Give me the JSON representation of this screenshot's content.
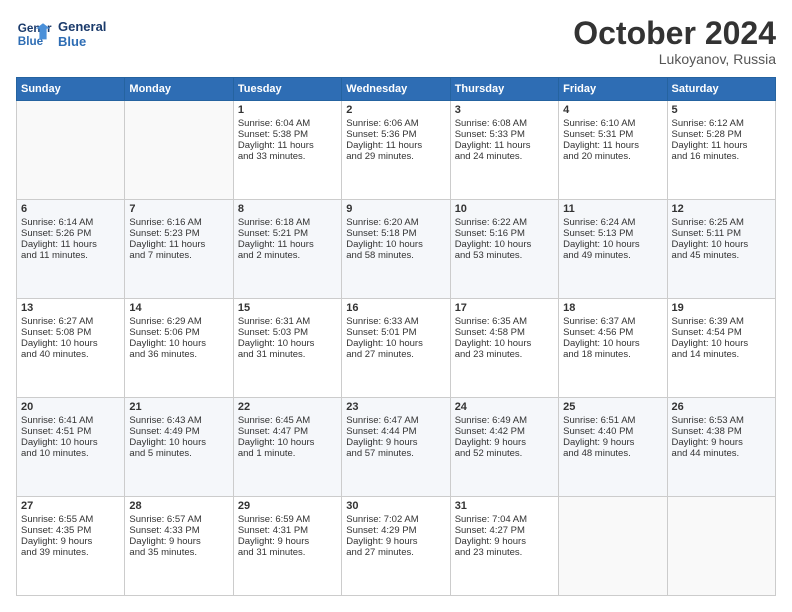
{
  "header": {
    "logo_line1": "General",
    "logo_line2": "Blue",
    "month": "October 2024",
    "location": "Lukoyanov, Russia"
  },
  "days_of_week": [
    "Sunday",
    "Monday",
    "Tuesday",
    "Wednesday",
    "Thursday",
    "Friday",
    "Saturday"
  ],
  "weeks": [
    [
      {
        "day": "",
        "content": ""
      },
      {
        "day": "",
        "content": ""
      },
      {
        "day": "1",
        "content": "Sunrise: 6:04 AM\nSunset: 5:38 PM\nDaylight: 11 hours\nand 33 minutes."
      },
      {
        "day": "2",
        "content": "Sunrise: 6:06 AM\nSunset: 5:36 PM\nDaylight: 11 hours\nand 29 minutes."
      },
      {
        "day": "3",
        "content": "Sunrise: 6:08 AM\nSunset: 5:33 PM\nDaylight: 11 hours\nand 24 minutes."
      },
      {
        "day": "4",
        "content": "Sunrise: 6:10 AM\nSunset: 5:31 PM\nDaylight: 11 hours\nand 20 minutes."
      },
      {
        "day": "5",
        "content": "Sunrise: 6:12 AM\nSunset: 5:28 PM\nDaylight: 11 hours\nand 16 minutes."
      }
    ],
    [
      {
        "day": "6",
        "content": "Sunrise: 6:14 AM\nSunset: 5:26 PM\nDaylight: 11 hours\nand 11 minutes."
      },
      {
        "day": "7",
        "content": "Sunrise: 6:16 AM\nSunset: 5:23 PM\nDaylight: 11 hours\nand 7 minutes."
      },
      {
        "day": "8",
        "content": "Sunrise: 6:18 AM\nSunset: 5:21 PM\nDaylight: 11 hours\nand 2 minutes."
      },
      {
        "day": "9",
        "content": "Sunrise: 6:20 AM\nSunset: 5:18 PM\nDaylight: 10 hours\nand 58 minutes."
      },
      {
        "day": "10",
        "content": "Sunrise: 6:22 AM\nSunset: 5:16 PM\nDaylight: 10 hours\nand 53 minutes."
      },
      {
        "day": "11",
        "content": "Sunrise: 6:24 AM\nSunset: 5:13 PM\nDaylight: 10 hours\nand 49 minutes."
      },
      {
        "day": "12",
        "content": "Sunrise: 6:25 AM\nSunset: 5:11 PM\nDaylight: 10 hours\nand 45 minutes."
      }
    ],
    [
      {
        "day": "13",
        "content": "Sunrise: 6:27 AM\nSunset: 5:08 PM\nDaylight: 10 hours\nand 40 minutes."
      },
      {
        "day": "14",
        "content": "Sunrise: 6:29 AM\nSunset: 5:06 PM\nDaylight: 10 hours\nand 36 minutes."
      },
      {
        "day": "15",
        "content": "Sunrise: 6:31 AM\nSunset: 5:03 PM\nDaylight: 10 hours\nand 31 minutes."
      },
      {
        "day": "16",
        "content": "Sunrise: 6:33 AM\nSunset: 5:01 PM\nDaylight: 10 hours\nand 27 minutes."
      },
      {
        "day": "17",
        "content": "Sunrise: 6:35 AM\nSunset: 4:58 PM\nDaylight: 10 hours\nand 23 minutes."
      },
      {
        "day": "18",
        "content": "Sunrise: 6:37 AM\nSunset: 4:56 PM\nDaylight: 10 hours\nand 18 minutes."
      },
      {
        "day": "19",
        "content": "Sunrise: 6:39 AM\nSunset: 4:54 PM\nDaylight: 10 hours\nand 14 minutes."
      }
    ],
    [
      {
        "day": "20",
        "content": "Sunrise: 6:41 AM\nSunset: 4:51 PM\nDaylight: 10 hours\nand 10 minutes."
      },
      {
        "day": "21",
        "content": "Sunrise: 6:43 AM\nSunset: 4:49 PM\nDaylight: 10 hours\nand 5 minutes."
      },
      {
        "day": "22",
        "content": "Sunrise: 6:45 AM\nSunset: 4:47 PM\nDaylight: 10 hours\nand 1 minute."
      },
      {
        "day": "23",
        "content": "Sunrise: 6:47 AM\nSunset: 4:44 PM\nDaylight: 9 hours\nand 57 minutes."
      },
      {
        "day": "24",
        "content": "Sunrise: 6:49 AM\nSunset: 4:42 PM\nDaylight: 9 hours\nand 52 minutes."
      },
      {
        "day": "25",
        "content": "Sunrise: 6:51 AM\nSunset: 4:40 PM\nDaylight: 9 hours\nand 48 minutes."
      },
      {
        "day": "26",
        "content": "Sunrise: 6:53 AM\nSunset: 4:38 PM\nDaylight: 9 hours\nand 44 minutes."
      }
    ],
    [
      {
        "day": "27",
        "content": "Sunrise: 6:55 AM\nSunset: 4:35 PM\nDaylight: 9 hours\nand 39 minutes."
      },
      {
        "day": "28",
        "content": "Sunrise: 6:57 AM\nSunset: 4:33 PM\nDaylight: 9 hours\nand 35 minutes."
      },
      {
        "day": "29",
        "content": "Sunrise: 6:59 AM\nSunset: 4:31 PM\nDaylight: 9 hours\nand 31 minutes."
      },
      {
        "day": "30",
        "content": "Sunrise: 7:02 AM\nSunset: 4:29 PM\nDaylight: 9 hours\nand 27 minutes."
      },
      {
        "day": "31",
        "content": "Sunrise: 7:04 AM\nSunset: 4:27 PM\nDaylight: 9 hours\nand 23 minutes."
      },
      {
        "day": "",
        "content": ""
      },
      {
        "day": "",
        "content": ""
      }
    ]
  ]
}
